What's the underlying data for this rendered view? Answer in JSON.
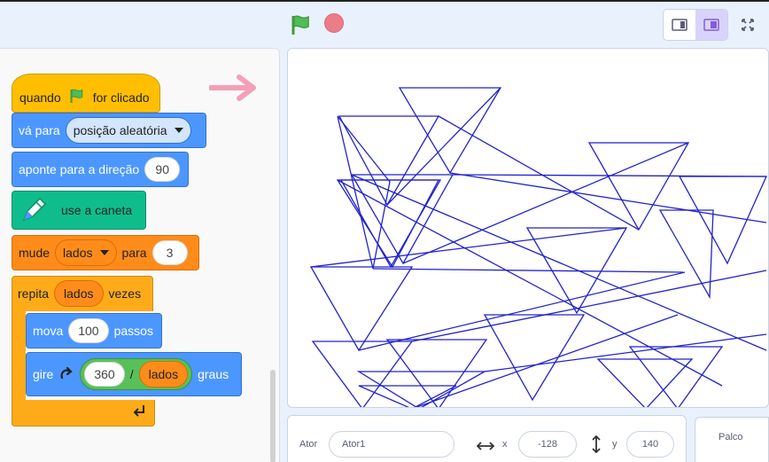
{
  "toolbar": {
    "green_flag": "flag-icon",
    "stop": "stop-icon",
    "layout_small": "small-stage-icon",
    "layout_normal": "normal-stage-icon",
    "fullscreen": "fullscreen-icon"
  },
  "code": {
    "hat": {
      "prefix": "quando",
      "suffix": "for clicado"
    },
    "goto": {
      "label": "vá para",
      "dropdown": "posição aleatória"
    },
    "point": {
      "label": "aponte para a direção",
      "value": "90"
    },
    "pen": {
      "label": "use a caneta"
    },
    "setvar": {
      "label": "mude",
      "var": "lados",
      "mid": "para",
      "value": "3"
    },
    "repeat": {
      "label": "repita",
      "var": "lados",
      "suffix": "vezes"
    },
    "move": {
      "label": "mova",
      "value": "100",
      "suffix": "passos"
    },
    "turn": {
      "label": "gire",
      "num": "360",
      "op": "/",
      "var": "lados",
      "suffix": "graus"
    }
  },
  "sprite": {
    "ator_label": "Ator",
    "ator_value": "Ator1",
    "x_label": "x",
    "x_value": "-128",
    "y_label": "y",
    "y_value": "140"
  },
  "stage_panel": {
    "title": "Palco"
  },
  "colors": {
    "motion": "#4c97ff",
    "events": "#ffbf00",
    "pen": "#0fbd8c",
    "variables": "#ff8c1a",
    "control": "#ffab19",
    "operators": "#59c059",
    "drawing": "#2222cc"
  }
}
